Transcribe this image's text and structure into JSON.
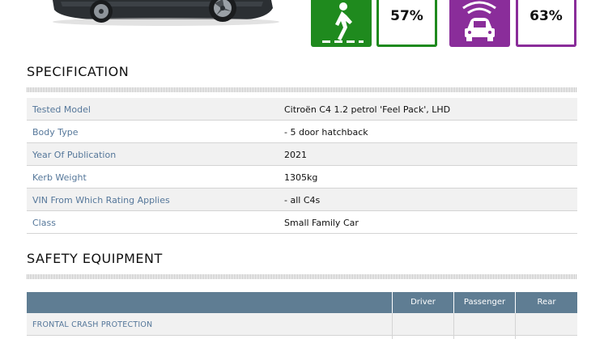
{
  "ratings": [
    {
      "icon": "pedestrian-icon",
      "score": "57%",
      "color": "#1f8a1e"
    },
    {
      "icon": "safety-assist-car-icon",
      "score": "63%",
      "color": "#8a2d9a"
    }
  ],
  "specification": {
    "title": "SPECIFICATION",
    "rows": [
      {
        "label": "Tested Model",
        "value": "Citroën C4 1.2 petrol 'Feel Pack', LHD"
      },
      {
        "label": "Body Type",
        "value": "- 5 door hatchback"
      },
      {
        "label": "Year Of Publication",
        "value": "2021"
      },
      {
        "label": "Kerb Weight",
        "value": "1305kg"
      },
      {
        "label": "VIN From Which Rating Applies",
        "value": "- all C4s"
      },
      {
        "label": "Class",
        "value": "Small Family Car"
      }
    ]
  },
  "safety_equipment": {
    "title": "SAFETY EQUIPMENT",
    "columns": [
      "Driver",
      "Passenger",
      "Rear"
    ],
    "rows": [
      {
        "label": "FRONTAL CRASH PROTECTION"
      }
    ]
  },
  "colors": {
    "label_blue": "#55779a",
    "table_header": "#5f7d93",
    "pedestrian_green": "#1f8a1e",
    "assist_purple": "#8a2d9a"
  }
}
